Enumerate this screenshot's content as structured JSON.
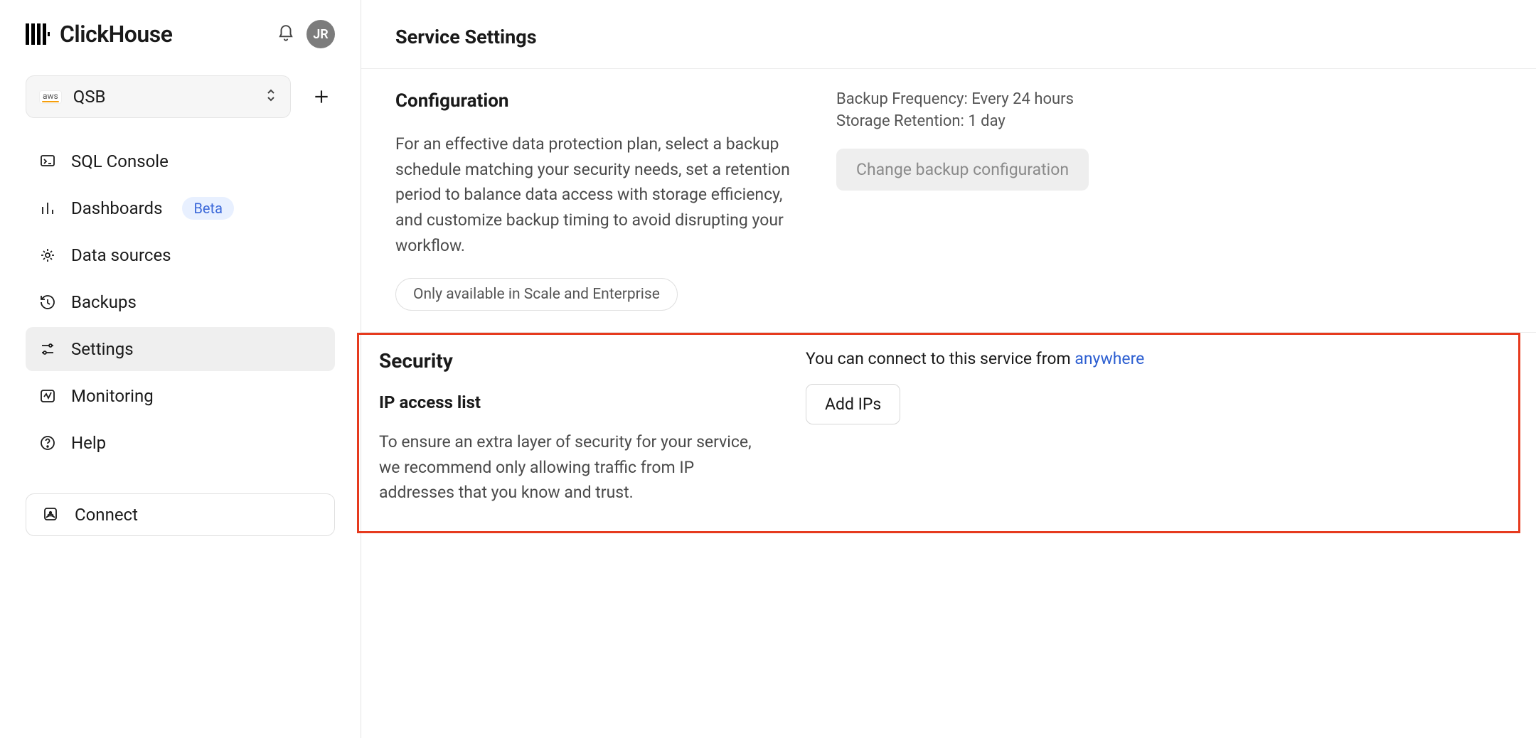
{
  "brand": {
    "name": "ClickHouse"
  },
  "user": {
    "initials": "JR"
  },
  "workspace": {
    "provider": "aws",
    "name": "QSB"
  },
  "nav": {
    "items": [
      {
        "label": "SQL Console"
      },
      {
        "label": "Dashboards",
        "badge": "Beta"
      },
      {
        "label": "Data sources"
      },
      {
        "label": "Backups"
      },
      {
        "label": "Settings"
      },
      {
        "label": "Monitoring"
      },
      {
        "label": "Help"
      }
    ],
    "connect": "Connect"
  },
  "page": {
    "title": "Service Settings"
  },
  "configuration": {
    "heading": "Configuration",
    "description": "For an effective data protection plan, select a backup schedule matching your security needs, set a retention period to balance data access with storage efficiency, and customize backup timing to avoid disrupting your workflow.",
    "restriction": "Only available in Scale and Enterprise",
    "backup_frequency_label": "Backup Frequency:",
    "backup_frequency_value": "Every 24 hours",
    "storage_retention_label": "Storage Retention:",
    "storage_retention_value": "1 day",
    "change_button": "Change backup configuration"
  },
  "security": {
    "heading": "Security",
    "ip_heading": "IP access list",
    "ip_description": "To ensure an extra layer of security for your service, we recommend only allowing traffic from IP addresses that you know and trust.",
    "connect_prefix": "You can connect to this service from ",
    "anywhere": "anywhere",
    "add_button": "Add IPs"
  }
}
